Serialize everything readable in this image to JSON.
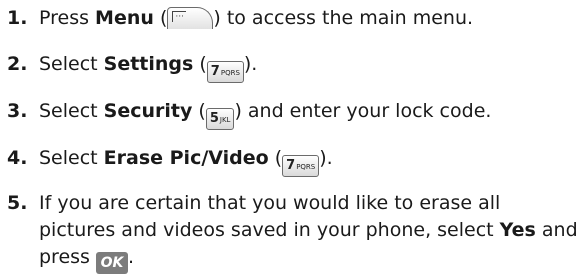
{
  "steps": [
    {
      "number": "1.",
      "before": "Press ",
      "bold": "Menu",
      "after": " to access the main menu.",
      "key_icon": "menu-softkey-icon"
    },
    {
      "number": "2.",
      "before": "Select ",
      "bold": "Settings",
      "key_digit": "7",
      "key_letters": "PQRS",
      "key_icon": "key-7-pqrs-icon"
    },
    {
      "number": "3.",
      "before": "Select ",
      "bold": "Security",
      "after": " and enter your lock code.",
      "key_digit": "5",
      "key_letters": "JKL",
      "key_icon": "key-5-jkl-icon"
    },
    {
      "number": "4.",
      "before": "Select ",
      "bold": "Erase Pic/Video",
      "key_digit": "7",
      "key_letters": "PQRS",
      "key_icon": "key-7-pqrs-icon"
    },
    {
      "number": "5.",
      "line1": "If you are certain that you would like to erase all",
      "line2_before": "pictures and videos saved in your phone, select ",
      "line2_bold": "Yes",
      "line2_after": " and",
      "line3_before": "press",
      "ok_label": "OK",
      "key_icon": "ok-key-icon"
    }
  ]
}
